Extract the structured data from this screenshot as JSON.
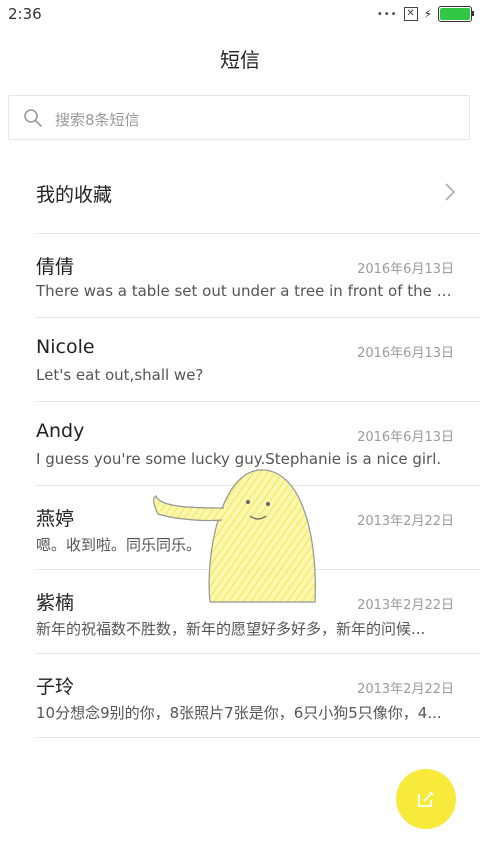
{
  "status_bar": {
    "time": "2:36",
    "battery_color": "#32c744"
  },
  "header": {
    "title": "短信"
  },
  "search": {
    "placeholder": "搜索8条短信"
  },
  "favorites": {
    "label": "我的收藏"
  },
  "messages": [
    {
      "name": "倩倩",
      "date": "2016年6月13日",
      "preview": "There was a table set out under a tree in front of the ho..."
    },
    {
      "name": "Nicole",
      "date": "2016年6月13日",
      "preview": "Let's eat out,shall we?"
    },
    {
      "name": "Andy",
      "date": "2016年6月13日",
      "preview": "I guess you're some lucky guy.Stephanie is a nice girl."
    },
    {
      "name": "燕婷",
      "date": "2013年2月22日",
      "preview": "嗯。收到啦。同乐同乐。"
    },
    {
      "name": "紫楠",
      "date": "2013年2月22日",
      "preview": "新年的祝福数不胜数，新年的愿望好多好多，新年的问候..."
    },
    {
      "name": "子玲",
      "date": "2013年2月22日",
      "preview": "10分想念9别的你，8张照片7张是你，6只小狗5只像你，4..."
    }
  ],
  "fab": {
    "icon": "compose-icon",
    "color": "#f7ea3a"
  }
}
